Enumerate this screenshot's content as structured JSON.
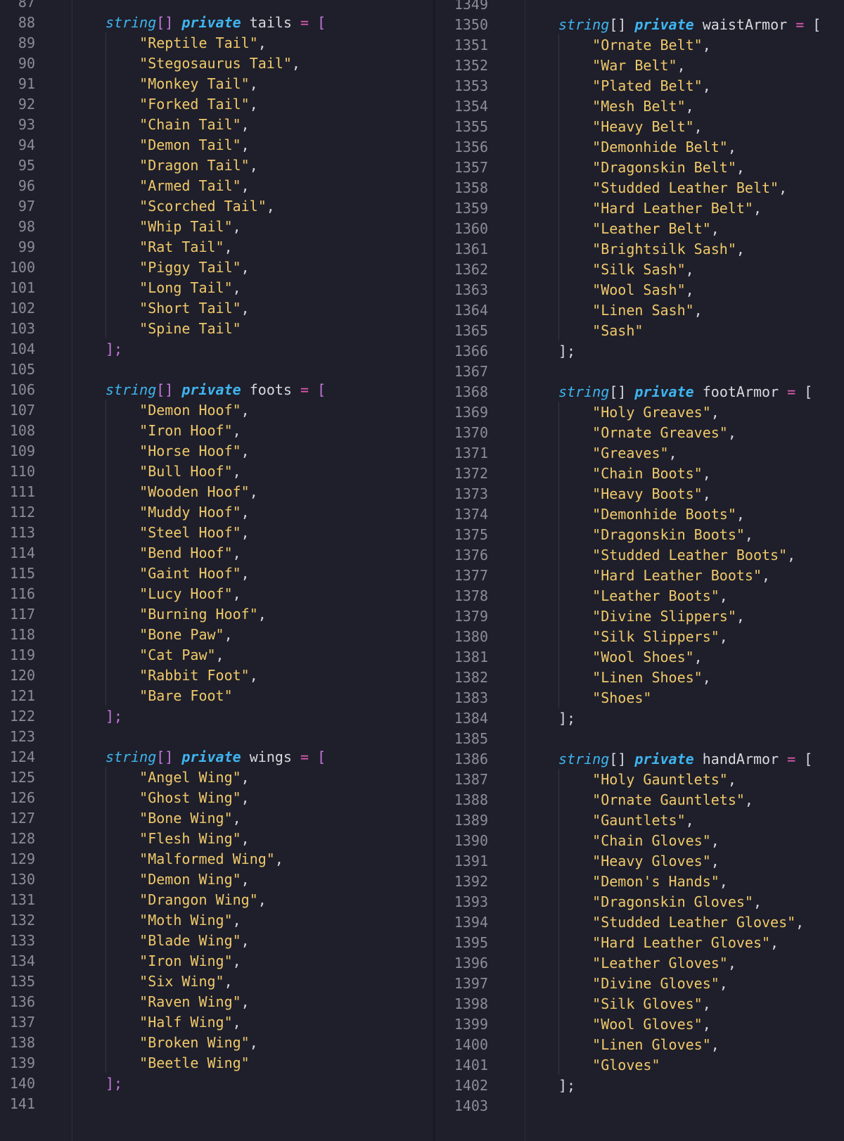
{
  "colors": {
    "background": "#1e1f2a",
    "line_number": "#8a8c99",
    "keyword": "#3fb5f0",
    "string": "#f1c96b",
    "bracket": "#c678dd",
    "operator": "#e05bb0",
    "identifier": "#d8d8e0"
  },
  "left_pane": {
    "first_line_number": 87,
    "blocks": [
      {
        "type_kw": "string",
        "brackets": "[]",
        "modifier": "private",
        "name": "tails",
        "eq": "=",
        "open": "[",
        "close": "];",
        "items": [
          "\"Reptile Tail\"",
          "\"Stegosaurus Tail\"",
          "\"Monkey Tail\"",
          "\"Forked Tail\"",
          "\"Chain Tail\"",
          "\"Demon Tail\"",
          "\"Dragon Tail\"",
          "\"Armed Tail\"",
          "\"Scorched Tail\"",
          "\"Whip Tail\"",
          "\"Rat Tail\"",
          "\"Piggy Tail\"",
          "\"Long Tail\"",
          "\"Short Tail\"",
          "\"Spine Tail\""
        ]
      },
      {
        "type_kw": "string",
        "brackets": "[]",
        "modifier": "private",
        "name": "foots",
        "eq": "=",
        "open": "[",
        "close": "];",
        "items": [
          "\"Demon Hoof\"",
          "\"Iron Hoof\"",
          "\"Horse Hoof\"",
          "\"Bull Hoof\"",
          "\"Wooden Hoof\"",
          "\"Muddy Hoof\"",
          "\"Steel Hoof\"",
          "\"Bend Hoof\"",
          "\"Gaint Hoof\"",
          "\"Lucy Hoof\"",
          "\"Burning Hoof\"",
          "\"Bone Paw\"",
          "\"Cat Paw\"",
          "\"Rabbit Foot\"",
          "\"Bare Foot\""
        ]
      },
      {
        "type_kw": "string",
        "brackets": "[]",
        "modifier": "private",
        "name": "wings",
        "eq": "=",
        "open": "[",
        "close": "];",
        "items": [
          "\"Angel Wing\"",
          "\"Ghost Wing\"",
          "\"Bone Wing\"",
          "\"Flesh Wing\"",
          "\"Malformed Wing\"",
          "\"Demon Wing\"",
          "\"Drangon Wing\"",
          "\"Moth Wing\"",
          "\"Blade Wing\"",
          "\"Iron Wing\"",
          "\"Six Wing\"",
          "\"Raven Wing\"",
          "\"Half Wing\"",
          "\"Broken Wing\"",
          "\"Beetle Wing\""
        ]
      }
    ]
  },
  "right_pane": {
    "first_line_number": 1349,
    "blocks": [
      {
        "type_kw": "string",
        "brackets": "[]",
        "modifier": "private",
        "name": "waistArmor",
        "eq": "=",
        "open": "[",
        "close": "];",
        "items": [
          "\"Ornate Belt\"",
          "\"War Belt\"",
          "\"Plated Belt\"",
          "\"Mesh Belt\"",
          "\"Heavy Belt\"",
          "\"Demonhide Belt\"",
          "\"Dragonskin Belt\"",
          "\"Studded Leather Belt\"",
          "\"Hard Leather Belt\"",
          "\"Leather Belt\"",
          "\"Brightsilk Sash\"",
          "\"Silk Sash\"",
          "\"Wool Sash\"",
          "\"Linen Sash\"",
          "\"Sash\""
        ]
      },
      {
        "type_kw": "string",
        "brackets": "[]",
        "modifier": "private",
        "name": "footArmor",
        "eq": "=",
        "open": "[",
        "close": "];",
        "items": [
          "\"Holy Greaves\"",
          "\"Ornate Greaves\"",
          "\"Greaves\"",
          "\"Chain Boots\"",
          "\"Heavy Boots\"",
          "\"Demonhide Boots\"",
          "\"Dragonskin Boots\"",
          "\"Studded Leather Boots\"",
          "\"Hard Leather Boots\"",
          "\"Leather Boots\"",
          "\"Divine Slippers\"",
          "\"Silk Slippers\"",
          "\"Wool Shoes\"",
          "\"Linen Shoes\"",
          "\"Shoes\""
        ]
      },
      {
        "type_kw": "string",
        "brackets": "[]",
        "modifier": "private",
        "name": "handArmor",
        "eq": "=",
        "open": "[",
        "close": "];",
        "items": [
          "\"Holy Gauntlets\"",
          "\"Ornate Gauntlets\"",
          "\"Gauntlets\"",
          "\"Chain Gloves\"",
          "\"Heavy Gloves\"",
          "\"Demon's Hands\"",
          "\"Dragonskin Gloves\"",
          "\"Studded Leather Gloves\"",
          "\"Hard Leather Gloves\"",
          "\"Leather Gloves\"",
          "\"Divine Gloves\"",
          "\"Silk Gloves\"",
          "\"Wool Gloves\"",
          "\"Linen Gloves\"",
          "\"Gloves\""
        ]
      }
    ]
  }
}
